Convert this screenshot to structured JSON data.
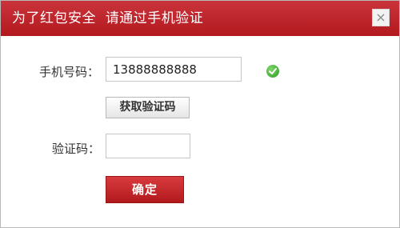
{
  "dialog": {
    "title": "为了红包安全  请通过手机验证",
    "close_label": "×"
  },
  "form": {
    "phone_label": "手机号码：",
    "phone_value": "13888888888",
    "get_code_label": "获取验证码",
    "code_label": "验证码：",
    "code_value": "",
    "confirm_label": "确定"
  },
  "icons": {
    "phone_status": "check-icon"
  },
  "colors": {
    "title_bar": "#b2191f",
    "confirm_button": "#c62a2d",
    "status_ok": "#3aa12c"
  }
}
